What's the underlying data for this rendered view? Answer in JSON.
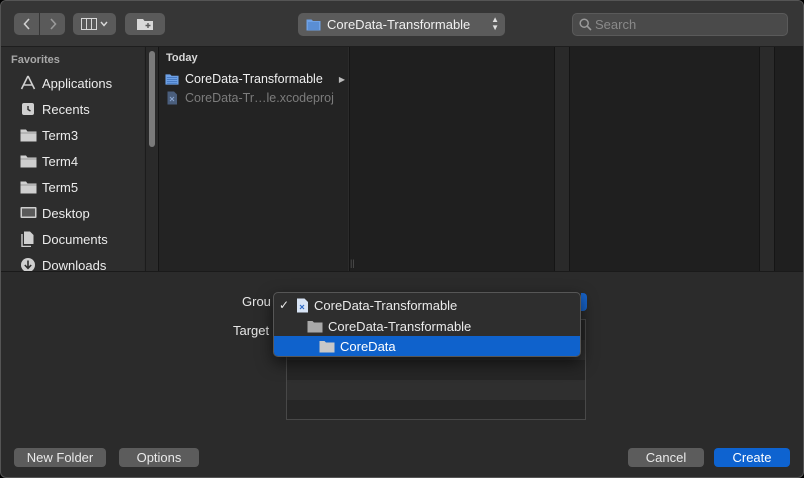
{
  "toolbar": {
    "back_icon": "chevron-left-icon",
    "forward_icon": "chevron-right-icon",
    "view_icon": "column-view-icon",
    "new_folder_icon": "new-folder-icon",
    "path_popup_label": "CoreData-Transformable",
    "search_placeholder": "Search"
  },
  "sidebar": {
    "heading": "Favorites",
    "items": [
      {
        "label": "Applications",
        "icon": "applications-icon"
      },
      {
        "label": "Recents",
        "icon": "recents-icon"
      },
      {
        "label": "Term3",
        "icon": "folder-icon"
      },
      {
        "label": "Term4",
        "icon": "folder-icon"
      },
      {
        "label": "Term5",
        "icon": "folder-icon"
      },
      {
        "label": "Desktop",
        "icon": "desktop-icon"
      },
      {
        "label": "Documents",
        "icon": "documents-icon"
      },
      {
        "label": "Downloads",
        "icon": "downloads-icon"
      }
    ]
  },
  "browser": {
    "column_heading": "Today",
    "rows": [
      {
        "label": "CoreData-Transformable",
        "icon": "folder-icon",
        "enabled": true
      },
      {
        "label": "CoreData-Tr…le.xcodeproj",
        "icon": "xcodeproj-icon",
        "enabled": false
      }
    ]
  },
  "options": {
    "group_label": "Grou",
    "targets_label": "Target",
    "group_menu": {
      "items": [
        {
          "label": "CoreData-Transformable",
          "icon": "project-icon",
          "checked": true
        },
        {
          "label": "CoreData-Transformable",
          "icon": "folder-icon",
          "checked": false
        },
        {
          "label": "CoreData",
          "icon": "folder-icon",
          "checked": false,
          "highlighted": true
        }
      ]
    }
  },
  "buttons": {
    "new_folder": "New Folder",
    "options": "Options",
    "cancel": "Cancel",
    "create": "Create"
  },
  "colors": {
    "accent": "#0e63d0",
    "window_bg": "#2b2b2b",
    "column_bg": "#1f1f1f"
  }
}
